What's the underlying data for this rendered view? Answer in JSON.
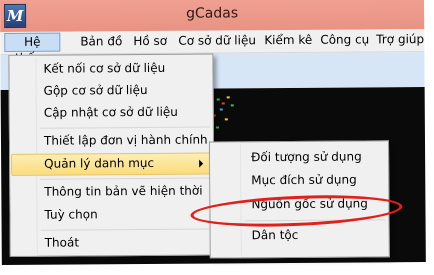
{
  "window": {
    "title": "gCadas",
    "icon_label": "M"
  },
  "menubar": {
    "items": [
      "Hệ thống",
      "Bản đồ",
      "Hồ sơ",
      "Cơ sở dữ liệu",
      "Kiểm kê",
      "Công cụ",
      "Trợ giúp"
    ]
  },
  "system_menu": {
    "items": [
      "Kết nối cơ sở dữ liệu",
      "Gộp cơ sở dữ liệu",
      "Cập nhật cơ sở dữ liệu",
      "Thiết lập đơn vị hành chính",
      "Quản lý danh mục",
      "Thông tin bản vẽ hiện thời",
      "Tuỳ chọn",
      "Thoát"
    ]
  },
  "catalog_submenu": {
    "items": [
      "Đối tượng sử dụng",
      "Mục đích sử dụng",
      "Nguồn gốc sử dụng",
      "Dân tộc"
    ]
  },
  "colors": {
    "titlebar": "#ea9587",
    "highlight": "#fbdc7c",
    "annotation": "#e0201b"
  }
}
